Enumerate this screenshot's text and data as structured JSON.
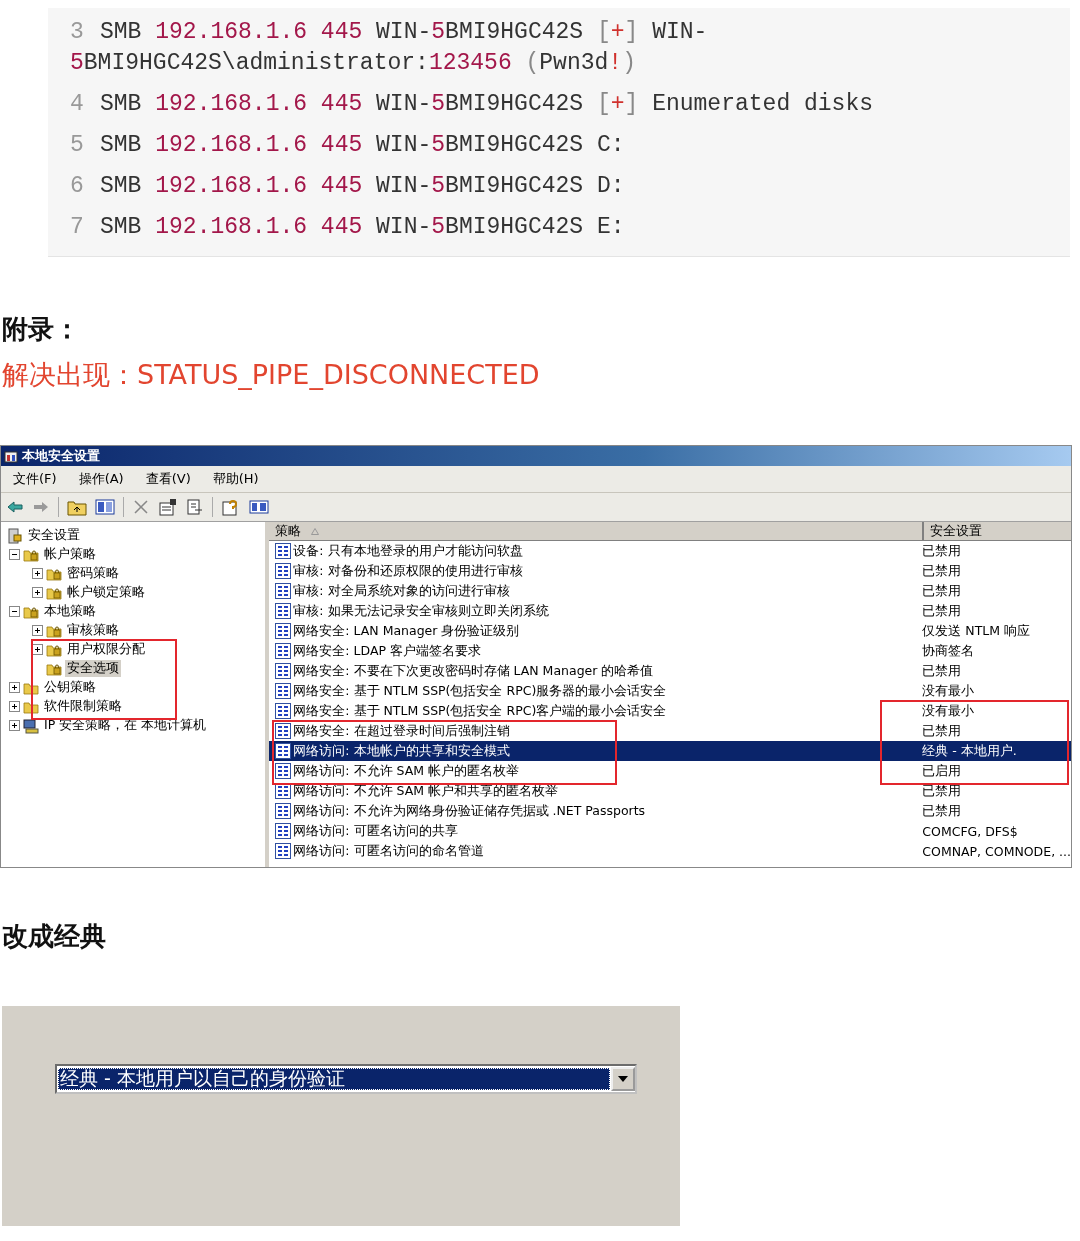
{
  "code_block": {
    "lines": [
      {
        "number": "3",
        "rows": [
          {
            "tokens": [
              {
                "text": "SMB ",
                "kind": "plain"
              },
              {
                "text": "192.168.1.6",
                "kind": "num"
              },
              {
                "text": " 445",
                "kind": "num"
              },
              {
                "text": " WIN-",
                "kind": "plain"
              },
              {
                "text": "5",
                "kind": "num"
              },
              {
                "text": "BMI9HGC42S ",
                "kind": "plain"
              },
              {
                "text": "[",
                "kind": "punct"
              },
              {
                "text": "+",
                "kind": "op"
              },
              {
                "text": "]",
                "kind": "punct"
              },
              {
                "text": " WIN-",
                "kind": "plain"
              }
            ]
          },
          {
            "tokens": [
              {
                "text": "5",
                "kind": "num"
              },
              {
                "text": "BMI9HGC42S\\administrator:",
                "kind": "plain"
              },
              {
                "text": "123456",
                "kind": "num"
              },
              {
                "text": " (",
                "kind": "punct"
              },
              {
                "text": "Pwn3d",
                "kind": "plain"
              },
              {
                "text": "!",
                "kind": "op"
              },
              {
                "text": ")",
                "kind": "punct"
              }
            ]
          }
        ]
      },
      {
        "number": "4",
        "rows": [
          {
            "tokens": [
              {
                "text": "SMB ",
                "kind": "plain"
              },
              {
                "text": "192.168.1.6",
                "kind": "num"
              },
              {
                "text": " 445",
                "kind": "num"
              },
              {
                "text": " WIN-",
                "kind": "plain"
              },
              {
                "text": "5",
                "kind": "num"
              },
              {
                "text": "BMI9HGC42S ",
                "kind": "plain"
              },
              {
                "text": "[",
                "kind": "punct"
              },
              {
                "text": "+",
                "kind": "op"
              },
              {
                "text": "]",
                "kind": "punct"
              },
              {
                "text": " Enumerated disks",
                "kind": "plain"
              }
            ]
          }
        ]
      },
      {
        "number": "5",
        "rows": [
          {
            "tokens": [
              {
                "text": "SMB ",
                "kind": "plain"
              },
              {
                "text": "192.168.1.6",
                "kind": "num"
              },
              {
                "text": " 445",
                "kind": "num"
              },
              {
                "text": " WIN-",
                "kind": "plain"
              },
              {
                "text": "5",
                "kind": "num"
              },
              {
                "text": "BMI9HGC42S C:",
                "kind": "plain"
              }
            ]
          }
        ]
      },
      {
        "number": "6",
        "rows": [
          {
            "tokens": [
              {
                "text": "SMB ",
                "kind": "plain"
              },
              {
                "text": "192.168.1.6",
                "kind": "num"
              },
              {
                "text": " 445",
                "kind": "num"
              },
              {
                "text": " WIN-",
                "kind": "plain"
              },
              {
                "text": "5",
                "kind": "num"
              },
              {
                "text": "BMI9HGC42S D:",
                "kind": "plain"
              }
            ]
          }
        ]
      },
      {
        "number": "7",
        "rows": [
          {
            "tokens": [
              {
                "text": "SMB ",
                "kind": "plain"
              },
              {
                "text": "192.168.1.6",
                "kind": "num"
              },
              {
                "text": " 445",
                "kind": "num"
              },
              {
                "text": " WIN-",
                "kind": "plain"
              },
              {
                "text": "5",
                "kind": "num"
              },
              {
                "text": "BMI9HGC42S E:",
                "kind": "plain"
              }
            ]
          }
        ]
      }
    ]
  },
  "appendix_heading": "附录：",
  "problem_heading": "解决出现：STATUS_PIPE_DISCONNECTED",
  "window": {
    "title": "本地安全设置",
    "menu": [
      "文件(F)",
      "操作(A)",
      "查看(V)",
      "帮助(H)"
    ],
    "tree": [
      {
        "label": "安全设置",
        "kind": "root",
        "selected": false,
        "children": [
          {
            "label": "帐户策略",
            "kind": "locked-folder",
            "expanded": true,
            "selected": false,
            "children": [
              {
                "label": "密码策略",
                "kind": "locked-folder",
                "expanded": false,
                "selected": false
              },
              {
                "label": "帐户锁定策略",
                "kind": "locked-folder",
                "expanded": false,
                "selected": false
              }
            ]
          },
          {
            "label": "本地策略",
            "kind": "locked-folder",
            "expanded": true,
            "selected": false,
            "children": [
              {
                "label": "审核策略",
                "kind": "locked-folder",
                "expanded": false,
                "selected": false
              },
              {
                "label": "用户权限分配",
                "kind": "locked-folder",
                "expanded": false,
                "selected": false
              },
              {
                "label": "安全选项",
                "kind": "locked-folder",
                "selected": true
              }
            ]
          },
          {
            "label": "公钥策略",
            "kind": "folder",
            "expanded": false,
            "selected": false
          },
          {
            "label": "软件限制策略",
            "kind": "folder",
            "expanded": false,
            "selected": false
          },
          {
            "label": "IP 安全策略，在 本地计算机",
            "kind": "network",
            "expanded": false,
            "selected": false
          }
        ]
      }
    ],
    "columns": [
      "策略",
      "安全设置"
    ],
    "rows": [
      {
        "policy": "设备: 只有本地登录的用户才能访问软盘",
        "setting": "已禁用",
        "selected": false
      },
      {
        "policy": "审核: 对备份和还原权限的使用进行审核",
        "setting": "已禁用",
        "selected": false
      },
      {
        "policy": "审核: 对全局系统对象的访问进行审核",
        "setting": "已禁用",
        "selected": false
      },
      {
        "policy": "审核: 如果无法记录安全审核则立即关闭系统",
        "setting": "已禁用",
        "selected": false
      },
      {
        "policy": "网络安全: LAN Manager 身份验证级别",
        "setting": "仅发送 NTLM 响应",
        "selected": false
      },
      {
        "policy": "网络安全: LDAP 客户端签名要求",
        "setting": "协商签名",
        "selected": false
      },
      {
        "policy": "网络安全: 不要在下次更改密码时存储 LAN Manager 的哈希值",
        "setting": "已禁用",
        "selected": false
      },
      {
        "policy": "网络安全: 基于 NTLM SSP(包括安全 RPC)服务器的最小会话安全",
        "setting": "没有最小",
        "selected": false
      },
      {
        "policy": "网络安全: 基于 NTLM SSP(包括安全 RPC)客户端的最小会话安全",
        "setting": "没有最小",
        "selected": false
      },
      {
        "policy": "网络安全: 在超过登录时间后强制注销",
        "setting": "已禁用",
        "selected": false
      },
      {
        "policy": "网络访问: 本地帐户的共享和安全模式",
        "setting": "经典 - 本地用户.",
        "selected": true
      },
      {
        "policy": "网络访问: 不允许 SAM 帐户的匿名枚举",
        "setting": "已启用",
        "selected": false
      },
      {
        "policy": "网络访问: 不允许 SAM 帐户和共享的匿名枚举",
        "setting": "已禁用",
        "selected": false
      },
      {
        "policy": "网络访问: 不允许为网络身份验证储存凭据或 .NET Passports",
        "setting": "已禁用",
        "selected": false
      },
      {
        "policy": "网络访问: 可匿名访问的共享",
        "setting": "COMCFG, DFS$",
        "selected": false
      },
      {
        "policy": "网络访问: 可匿名访问的命名管道",
        "setting": "COMNAP, COMNODE, ...",
        "selected": false
      }
    ]
  },
  "change_heading": "改成经典",
  "dialog": {
    "dropdown": {
      "value": "经典 - 本地用户以自己的身份验证"
    }
  }
}
